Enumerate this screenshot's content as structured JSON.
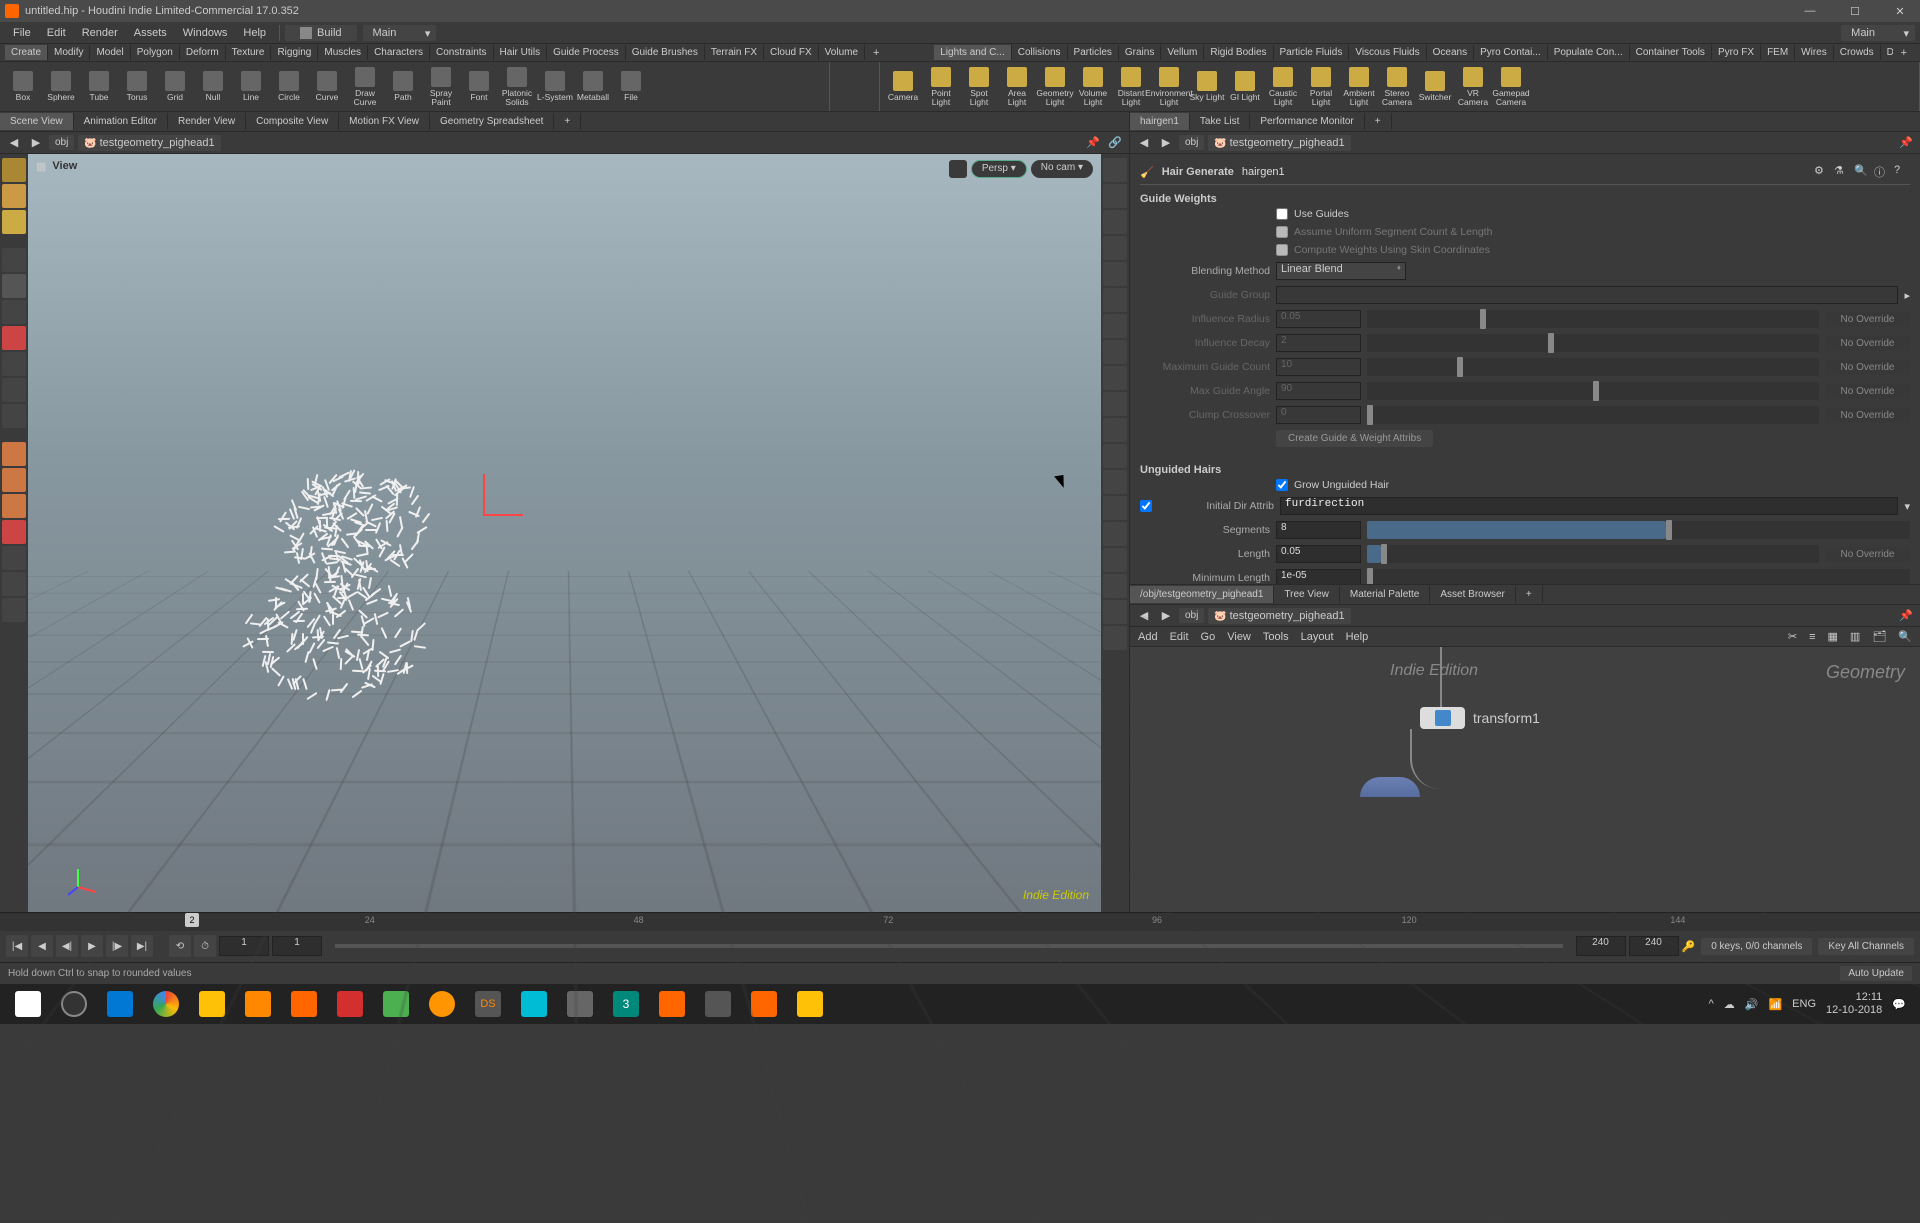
{
  "titlebar": {
    "text": "untitled.hip - Houdini Indie Limited-Commercial 17.0.352"
  },
  "menubar": {
    "items": [
      "File",
      "Edit",
      "Render",
      "Assets",
      "Windows",
      "Help"
    ],
    "build": "Build",
    "main": "Main",
    "main_right": "Main"
  },
  "shelf_tabs_left": [
    "Create",
    "Modify",
    "Model",
    "Polygon",
    "Deform",
    "Texture",
    "Rigging",
    "Muscles",
    "Characters",
    "Constraints",
    "Hair Utils",
    "Guide Process",
    "Guide Brushes",
    "Terrain FX",
    "Cloud FX",
    "Volume"
  ],
  "shelf_tabs_right": [
    "Lights and C...",
    "Collisions",
    "Particles",
    "Grains",
    "Vellum",
    "Rigid Bodies",
    "Particle Fluids",
    "Viscous Fluids",
    "Oceans",
    "Pyro Contai...",
    "Populate Con...",
    "Container Tools",
    "Pyro FX",
    "FEM",
    "Wires",
    "Crowds",
    "Drive Simula..."
  ],
  "shelf_tools_left": [
    {
      "l": "Box"
    },
    {
      "l": "Sphere"
    },
    {
      "l": "Tube"
    },
    {
      "l": "Torus"
    },
    {
      "l": "Grid"
    },
    {
      "l": "Null"
    },
    {
      "l": "Line"
    },
    {
      "l": "Circle"
    },
    {
      "l": "Curve"
    },
    {
      "l": "Draw Curve"
    },
    {
      "l": "Path"
    },
    {
      "l": "Spray Paint"
    },
    {
      "l": "Font"
    },
    {
      "l": "Platonic Solids"
    },
    {
      "l": "L-System"
    },
    {
      "l": "Metaball"
    },
    {
      "l": "File"
    }
  ],
  "shelf_tools_right": [
    {
      "l": "Camera"
    },
    {
      "l": "Point Light"
    },
    {
      "l": "Spot Light"
    },
    {
      "l": "Area Light"
    },
    {
      "l": "Geometry Light"
    },
    {
      "l": "Volume Light"
    },
    {
      "l": "Distant Light"
    },
    {
      "l": "Environment Light"
    },
    {
      "l": "Sky Light"
    },
    {
      "l": "GI Light"
    },
    {
      "l": "Caustic Light"
    },
    {
      "l": "Portal Light"
    },
    {
      "l": "Ambient Light"
    },
    {
      "l": "Stereo Camera"
    },
    {
      "l": "Switcher"
    },
    {
      "l": "VR Camera"
    },
    {
      "l": "Gamepad Camera"
    }
  ],
  "left_tabs": [
    "Scene View",
    "Animation Editor",
    "Render View",
    "Composite View",
    "Motion FX View",
    "Geometry Spreadsheet"
  ],
  "right_top_tabs": [
    "hairgen1",
    "Take List",
    "Performance Monitor"
  ],
  "path_left": {
    "obj": "obj",
    "node": "testgeometry_pighead1"
  },
  "path_right": {
    "obj": "obj",
    "node": "testgeometry_pighead1"
  },
  "viewport": {
    "view": "View",
    "persp": "Persp ▾",
    "nocam": "No cam ▾",
    "indie": "Indie Edition"
  },
  "params": {
    "title": "Hair Generate",
    "node": "hairgen1",
    "guide_weights": "Guide Weights",
    "use_guides": "Use Guides",
    "uniform": "Assume Uniform Segment Count & Length",
    "skin_coords": "Compute Weights Using Skin Coordinates",
    "blending_method": {
      "label": "Blending Method",
      "value": "Linear Blend"
    },
    "guide_group": {
      "label": "Guide Group",
      "value": ""
    },
    "influence_radius": {
      "label": "Influence Radius",
      "value": "0.05",
      "override": "No Override"
    },
    "influence_decay": {
      "label": "Influence Decay",
      "value": "2",
      "override": "No Override"
    },
    "max_guide_count": {
      "label": "Maximum Guide Count",
      "value": "10",
      "override": "No Override"
    },
    "max_guide_angle": {
      "label": "Max Guide Angle",
      "value": "90",
      "override": "No Override"
    },
    "clump_crossover": {
      "label": "Clump Crossover",
      "value": "0",
      "override": "No Override"
    },
    "create_attribs": "Create Guide & Weight Attribs",
    "unguided": "Unguided Hairs",
    "grow": "Grow Unguided Hair",
    "initial_dir": {
      "label": "Initial Dir Attrib",
      "value": "furdirection"
    },
    "segments": {
      "label": "Segments",
      "value": "8"
    },
    "length": {
      "label": "Length",
      "value": "0.05",
      "override": "No Override"
    },
    "min_length": {
      "label": "Minimum Length",
      "value": "1e-05"
    }
  },
  "net_tabs": [
    "/obj/testgeometry_pighead1",
    "Tree View",
    "Material Palette",
    "Asset Browser"
  ],
  "net_path": {
    "obj": "obj",
    "node": "testgeometry_pighead1"
  },
  "net_menu": [
    "Add",
    "Edit",
    "Go",
    "View",
    "Tools",
    "Layout",
    "Help"
  ],
  "network": {
    "indie": "Indie Edition",
    "geom": "Geometry",
    "node": "transform1"
  },
  "timeline": {
    "ticks": [
      {
        "p": 19,
        "l": "24"
      },
      {
        "p": 33,
        "l": "48"
      },
      {
        "p": 46,
        "l": "72"
      },
      {
        "p": 60,
        "l": "96"
      },
      {
        "p": 73,
        "l": "120"
      },
      {
        "p": 87,
        "l": "144"
      }
    ],
    "frame": "2",
    "start": "1",
    "cur": "1",
    "end1": "240",
    "end2": "240",
    "keys": "0 keys, 0/0 channels",
    "key_all": "Key All Channels"
  },
  "status": {
    "text": "Hold down Ctrl to snap to rounded values",
    "auto": "Auto Update"
  },
  "taskbar": {
    "lang": "ENG",
    "time": "12:11",
    "date": "12-10-2018"
  }
}
